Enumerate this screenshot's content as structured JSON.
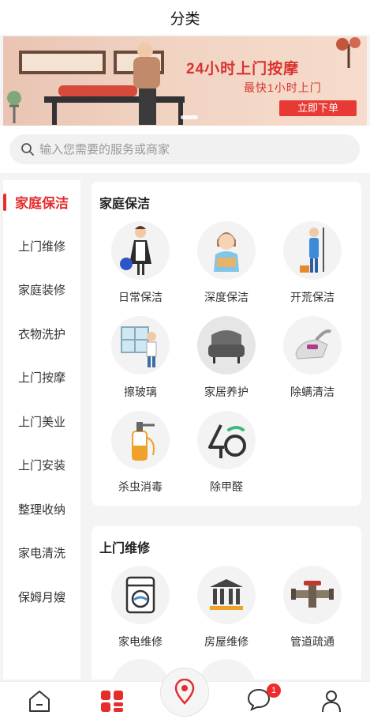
{
  "header": {
    "title": "分类"
  },
  "banner": {
    "headline": "24小时上门按摩",
    "subline": "最快1小时上门",
    "cta": "立即下单"
  },
  "search": {
    "placeholder": "输入您需要的服务或商家"
  },
  "sidebar": {
    "items": [
      {
        "label": "家庭保洁",
        "active": true
      },
      {
        "label": "上门维修"
      },
      {
        "label": "家庭装修"
      },
      {
        "label": "衣物洗护"
      },
      {
        "label": "上门按摩"
      },
      {
        "label": "上门美业"
      },
      {
        "label": "上门安装"
      },
      {
        "label": "整理收纳"
      },
      {
        "label": "家电清洗"
      },
      {
        "label": "保姆月嫂"
      }
    ]
  },
  "sections": [
    {
      "title": "家庭保洁",
      "items": [
        {
          "label": "日常保洁",
          "icon": "maid-icon"
        },
        {
          "label": "深度保洁",
          "icon": "cleaner-woman-icon"
        },
        {
          "label": "开荒保洁",
          "icon": "mop-worker-icon"
        },
        {
          "label": "擦玻璃",
          "icon": "window-cleaning-icon"
        },
        {
          "label": "家居养护",
          "icon": "armchair-icon"
        },
        {
          "label": "除螨清洁",
          "icon": "mite-vacuum-icon"
        },
        {
          "label": "杀虫消毒",
          "icon": "sprayer-icon"
        },
        {
          "label": "除甲醛",
          "icon": "formaldehyde-icon"
        }
      ]
    },
    {
      "title": "上门维修",
      "items": [
        {
          "label": "家电维修",
          "icon": "washing-machine-icon"
        },
        {
          "label": "房屋维修",
          "icon": "building-icon"
        },
        {
          "label": "管道疏通",
          "icon": "pipe-icon"
        }
      ]
    }
  ],
  "tabbar": {
    "badge": "1",
    "tabs": [
      {
        "name": "home-tab",
        "icon": "home-icon"
      },
      {
        "name": "category-tab",
        "icon": "category-icon",
        "active_color": "#e52d2d"
      },
      {
        "name": "location-tab",
        "icon": "location-pin-icon"
      },
      {
        "name": "message-tab",
        "icon": "chat-bubble-icon"
      },
      {
        "name": "profile-tab",
        "icon": "person-icon"
      }
    ]
  }
}
